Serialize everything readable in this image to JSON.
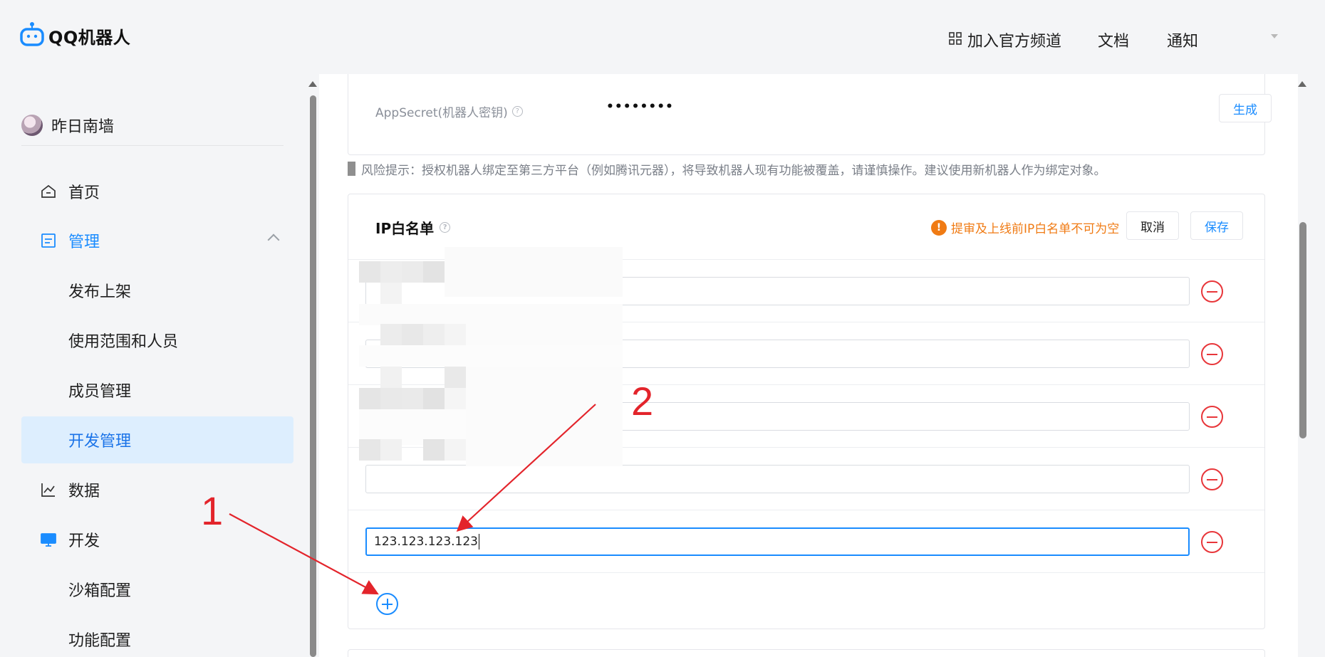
{
  "header": {
    "logo_text": "QQ机器人",
    "channel_label": "加入官方频道",
    "docs_label": "文档",
    "notice_label": "通知"
  },
  "sidebar": {
    "username": "昨日南墙",
    "items": [
      {
        "label": "首页",
        "icon": "home-icon"
      },
      {
        "label": "管理",
        "icon": "manage-icon"
      },
      {
        "label": "发布上架"
      },
      {
        "label": "使用范围和人员"
      },
      {
        "label": "成员管理"
      },
      {
        "label": "开发管理"
      },
      {
        "label": "数据",
        "icon": "chart-icon"
      },
      {
        "label": "开发",
        "icon": "monitor-icon"
      },
      {
        "label": "沙箱配置"
      },
      {
        "label": "功能配置"
      }
    ]
  },
  "secret": {
    "label": "AppSecret(机器人密钥)",
    "value": "••••••••",
    "generate_label": "生成"
  },
  "risk_notice": "风险提示：授权机器人绑定至第三方平台（例如腾讯元器），将导致机器人现有功能被覆盖，请谨慎操作。建议使用新机器人作为绑定对象。",
  "ip_whitelist": {
    "title": "IP白名单",
    "warning": "提审及上线前IP白名单不可为空",
    "cancel_label": "取消",
    "save_label": "保存",
    "entries": [
      "",
      "",
      "",
      "",
      "123.123.123.123"
    ]
  },
  "annotations": {
    "label_1": "1",
    "label_2": "2"
  },
  "colors": {
    "primary_blue": "#1a8cff",
    "danger_red": "#e8363a",
    "warning_orange": "#f07b14",
    "annotation_red": "#e3242b",
    "active_bg": "#ddeefe"
  }
}
